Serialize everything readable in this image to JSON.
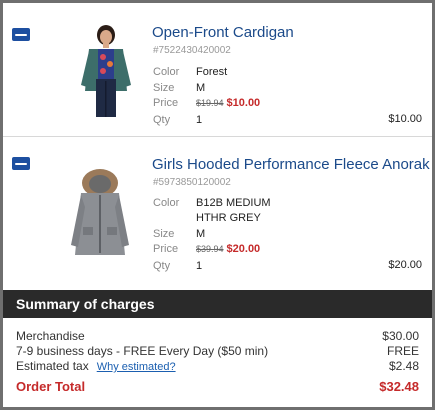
{
  "items": [
    {
      "brand_icon": "oldnavy-badge-icon",
      "title": "Open-Front Cardigan",
      "sku": "#7522430420002",
      "attrs": {
        "color_label": "Color",
        "color": "Forest",
        "size_label": "Size",
        "size": "M",
        "price_label": "Price",
        "orig_price": "$19.94",
        "sale_price": "$10.00",
        "qty_label": "Qty",
        "qty": "1"
      },
      "line_total": "$10.00"
    },
    {
      "brand_icon": "oldnavy-badge-icon",
      "title": "Girls Hooded Performance Fleece Anorak",
      "sku": "#5973850120002",
      "attrs": {
        "color_label": "Color",
        "color_line1": "B12B MEDIUM",
        "color_line2": "HTHR GREY",
        "size_label": "Size",
        "size": "M",
        "price_label": "Price",
        "orig_price": "$39.94",
        "sale_price": "$20.00",
        "qty_label": "Qty",
        "qty": "1"
      },
      "line_total": "$20.00"
    }
  ],
  "summary": {
    "heading": "Summary of charges",
    "merch_label": "Merchandise",
    "merch_value": "$30.00",
    "shipping_label": "7-9 business days - FREE Every Day ($50 min)",
    "shipping_value": "FREE",
    "tax_label": "Estimated tax",
    "tax_link": "Why estimated?",
    "tax_value": "$2.48",
    "total_label": "Order Total",
    "total_value": "$32.48"
  },
  "colors": {
    "link": "#1b4a8a",
    "sale": "#c52a2a",
    "summary_bar": "#2a2a2a",
    "brand": "#1d4fa0"
  }
}
